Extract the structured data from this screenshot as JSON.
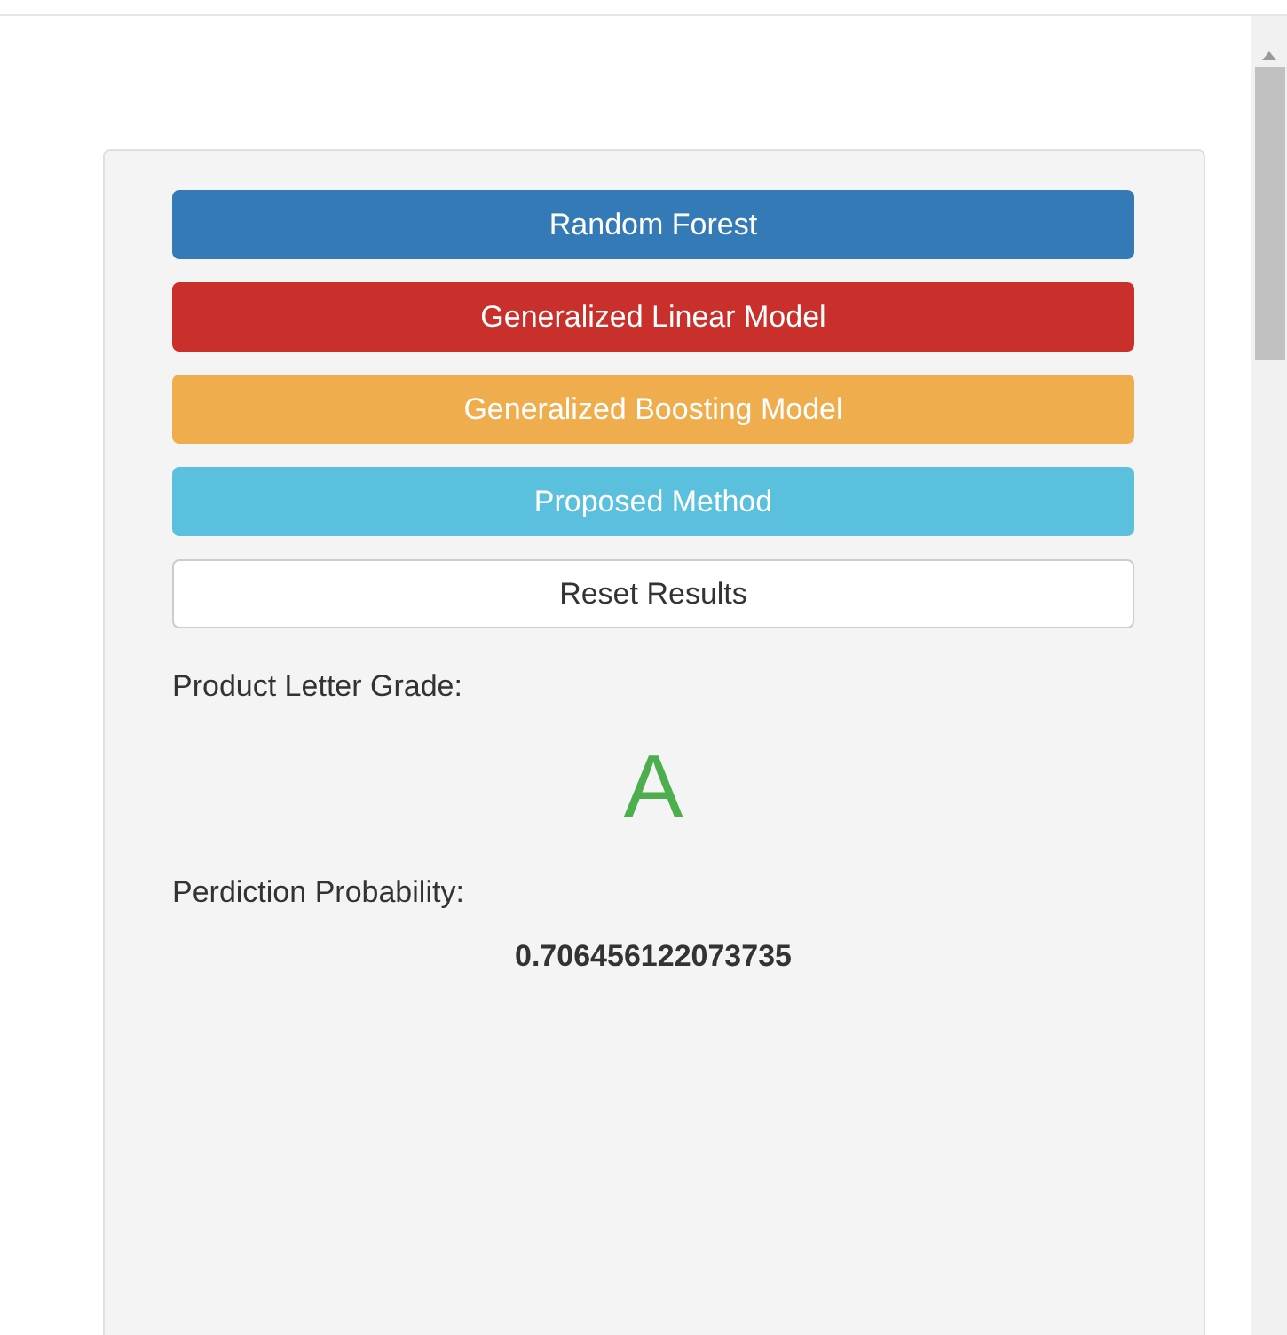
{
  "buttons": [
    {
      "label": "Random Forest",
      "color": "#337ab7"
    },
    {
      "label": "Generalized Linear Model",
      "color": "#c9302c"
    },
    {
      "label": "Generalized Boosting Model",
      "color": "#f0ad4e"
    },
    {
      "label": "Proposed Method",
      "color": "#5bc0de"
    },
    {
      "label": "Reset Results",
      "color": "#ffffff"
    }
  ],
  "grade_label": "Product Letter Grade:",
  "grade": "A",
  "probability_label": "Perdiction Probability:",
  "probability": "0.706456122073735"
}
